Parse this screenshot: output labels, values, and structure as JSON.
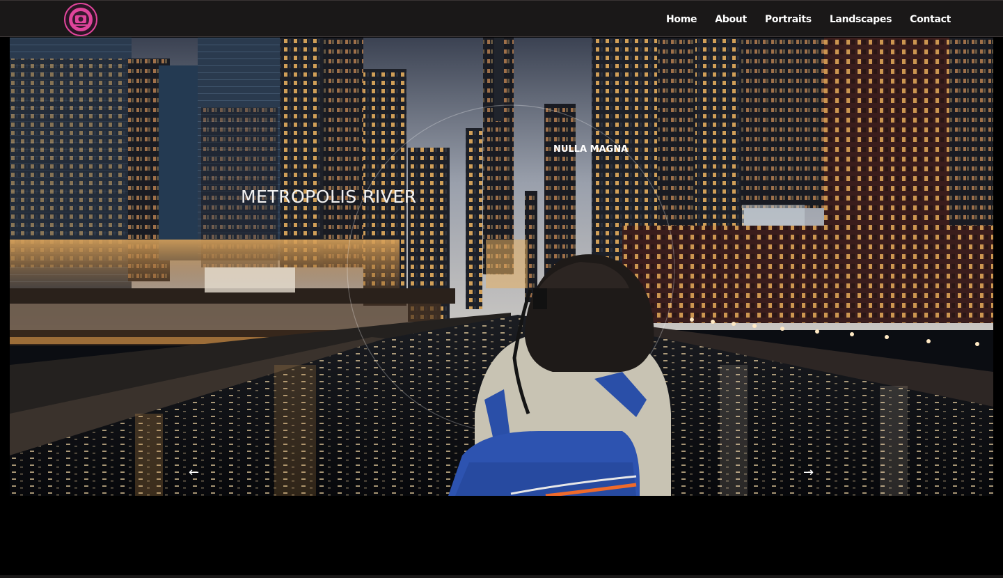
{
  "nav": {
    "logo_icon": "camera-logo-icon",
    "links": [
      "Home",
      "About",
      "Portraits",
      "Landscapes",
      "Contact"
    ]
  },
  "hero": {
    "title": "METROPOLIS RIVER",
    "subtitle": "NULLA MAGNA",
    "prev_icon": "arrow-left-icon",
    "next_icon": "arrow-right-icon",
    "prev_label": "←",
    "next_label": "→"
  },
  "colors": {
    "navbar_bg": "#1a1818",
    "logo_accent": "#e0459b",
    "page_bg": "#000000"
  }
}
